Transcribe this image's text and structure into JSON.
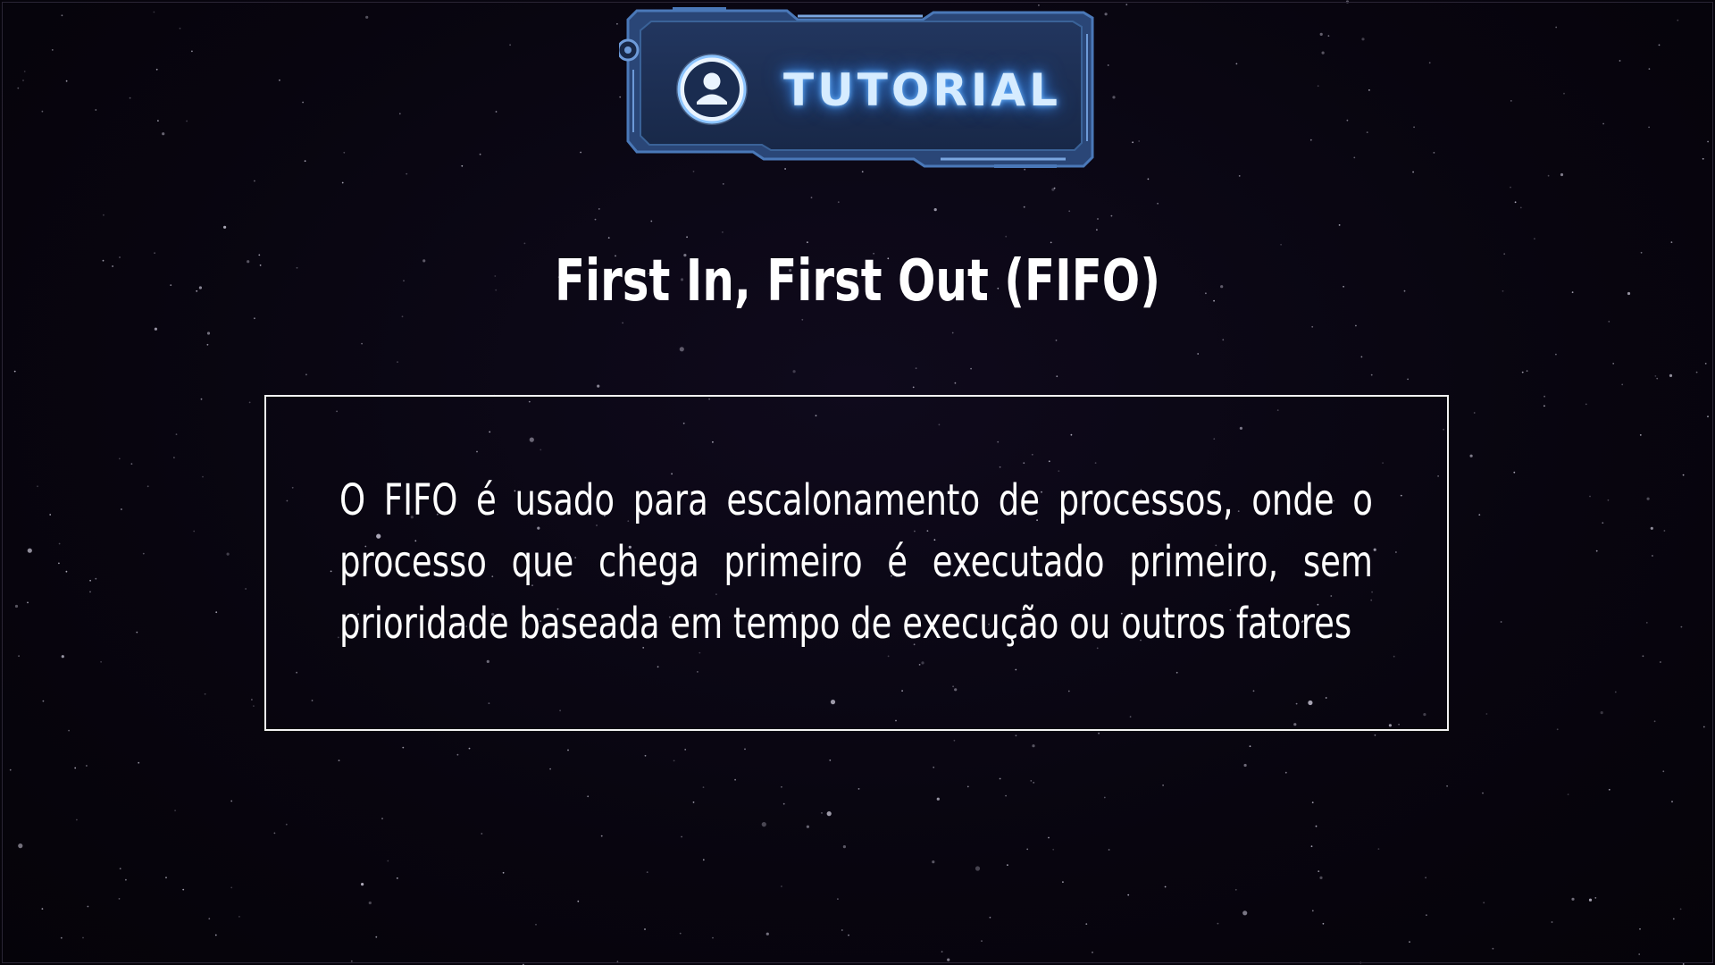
{
  "badge": {
    "label": "TUTORIAL",
    "icon": "user-avatar-icon",
    "glow_color": "#6fb6ff",
    "plate_color": "#1c2d52",
    "border_color": "#4a78b8"
  },
  "slide": {
    "title": "First In, First Out (FIFO)",
    "description": "O FIFO é usado para escalonamento de processos, onde o processo que chega primeiro é executado primeiro, sem prioridade baseada em tempo de execução ou outros fatores"
  },
  "theme": {
    "background": "#08050f",
    "text": "#ffffff",
    "box_border": "#f2f2f2"
  }
}
